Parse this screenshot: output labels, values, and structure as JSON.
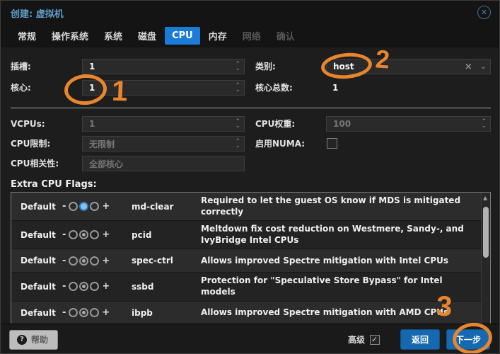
{
  "window": {
    "title": "创建: 虚拟机"
  },
  "icons": {
    "close": "✕",
    "spin_up": "⌃",
    "spin_down": "⌄",
    "combo_down": "⌄",
    "clear": "×",
    "scroll_up": "▲",
    "help": "?"
  },
  "tabs": [
    {
      "label": "常规",
      "state": "normal"
    },
    {
      "label": "操作系统",
      "state": "normal"
    },
    {
      "label": "系统",
      "state": "normal"
    },
    {
      "label": "磁盘",
      "state": "normal"
    },
    {
      "label": "CPU",
      "state": "active"
    },
    {
      "label": "内存",
      "state": "normal"
    },
    {
      "label": "网络",
      "state": "disabled"
    },
    {
      "label": "确认",
      "state": "disabled"
    }
  ],
  "form": {
    "sockets": {
      "label": "插槽:",
      "value": "1"
    },
    "cores": {
      "label": "核心:",
      "value": "1"
    },
    "type": {
      "label": "类别:",
      "value": "host"
    },
    "total_cores": {
      "label": "核心总数:",
      "value": "1"
    },
    "vcpus": {
      "label": "VCPUs:",
      "value": "1",
      "disabled": true
    },
    "cpu_limit": {
      "label": "CPU限制:",
      "placeholder": "无限制",
      "disabled": true
    },
    "cpu_affinity": {
      "label": "CPU相关性:",
      "placeholder": "全部核心",
      "disabled": true
    },
    "cpu_weight": {
      "label": "CPU权重:",
      "value": "100",
      "disabled": true
    },
    "numa": {
      "label": "启用NUMA:",
      "checked": false
    }
  },
  "flags_section": {
    "title": "Extra CPU Flags:",
    "default_label": "Default",
    "minus_label": "-",
    "plus_label": "+",
    "rows": [
      {
        "flag": "md-clear",
        "description": "Required to let the guest OS know if MDS is mitigated correctly",
        "selected": "default"
      },
      {
        "flag": "pcid",
        "description": "Meltdown fix cost reduction on Westmere, Sandy-, and IvyBridge Intel CPUs",
        "selected": "default"
      },
      {
        "flag": "spec-ctrl",
        "description": "Allows improved Spectre mitigation with Intel CPUs",
        "selected": "default"
      },
      {
        "flag": "ssbd",
        "description": "Protection for \"Speculative Store Bypass\" for Intel models",
        "selected": "default"
      },
      {
        "flag": "ibpb",
        "description": "Allows improved Spectre mitigation with AMD CPUs",
        "selected": "default"
      }
    ]
  },
  "footer": {
    "help_label": "帮助",
    "advanced_label": "高级",
    "advanced_checked": true,
    "back_label": "返回",
    "next_label": "下一步"
  },
  "annotations": {
    "color": "#e8862d",
    "step1": "1",
    "step2": "2",
    "step3": "3"
  },
  "colors": {
    "active_tab": "#1b7cd8",
    "button_blue": "#1668b1",
    "title_text": "#5f9fca",
    "annotation_orange": "#e8862d"
  }
}
